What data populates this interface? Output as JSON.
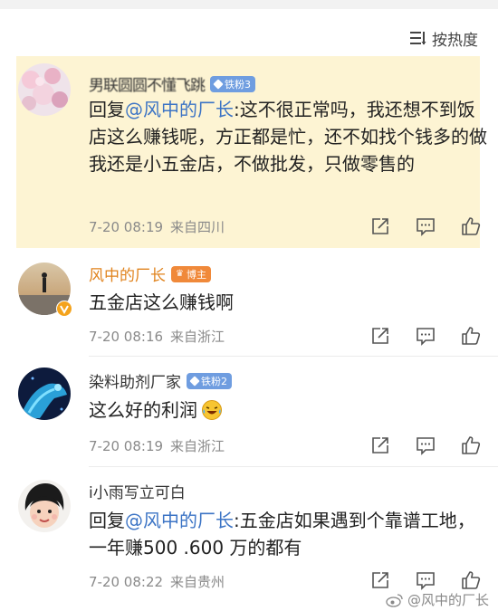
{
  "sort": {
    "label": "按热度",
    "icon": "sort-lines-icon"
  },
  "comments": [
    {
      "username": "男联圆圆不懂飞跳",
      "badge": "铁粉3",
      "reply_prefix": "回复",
      "mention": "@风中的厂长",
      "text": ":这不很正常吗，我还想不到饭店这么赚钱呢，方正都是忙，还不如找个钱多的做 我还是小五金店，不做批发，只做零售的",
      "time": "7-20 08:19",
      "location": "来自四川"
    },
    {
      "username": "风中的厂长",
      "badge": "博主",
      "text": "五金店这么赚钱啊",
      "time": "7-20 08:16",
      "location": "来自浙江"
    },
    {
      "username": "染料助剂厂家",
      "badge": "铁粉2",
      "text": "这么好的利润",
      "emoji": "laugh-cry-emoji",
      "time": "7-20 08:19",
      "location": "来自浙江"
    },
    {
      "username": "i小雨写立可白",
      "reply_prefix": "回复",
      "mention": "@风中的厂长",
      "text": ":五金店如果遇到个靠谱工地，一年赚500 .600 万的都有",
      "time": "7-20 08:22",
      "location": "来自贵州"
    }
  ],
  "watermark": "@风中的厂长",
  "colors": {
    "highlight_bg": "#fdf4d3",
    "orange_name": "#e0831d",
    "mention_blue": "#3c74c5",
    "fan_badge": "#6f9de0",
    "host_badge": "#f0893a"
  }
}
